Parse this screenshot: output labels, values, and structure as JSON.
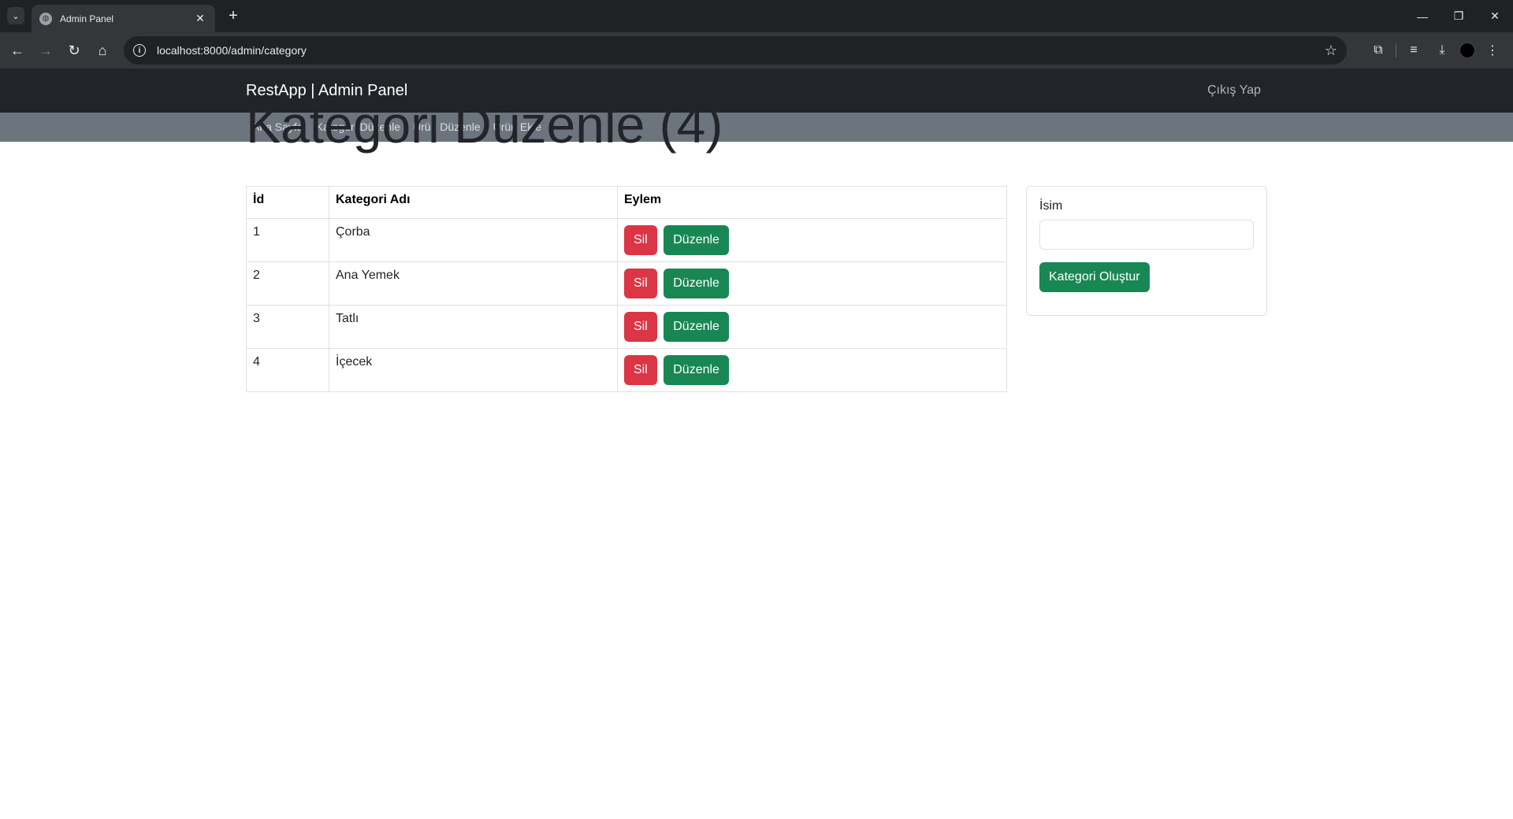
{
  "browser": {
    "tab_title": "Admin Panel",
    "new_tab_glyph": "+",
    "url": "localhost:8000/admin/category"
  },
  "navbar": {
    "brand": "RestApp | Admin Panel",
    "logout": "Çıkış Yap"
  },
  "subnav": {
    "items": [
      "Ana Sayfa",
      "Kategori Düzenle",
      "Ürün Düzenle",
      "Ürün Ekle"
    ]
  },
  "main": {
    "title": "Kategori Düzenle (4)",
    "table": {
      "headers": [
        "İd",
        "Kategori Adı",
        "Eylem"
      ],
      "rows": [
        {
          "id": "1",
          "name": "Çorba"
        },
        {
          "id": "2",
          "name": "Ana Yemek"
        },
        {
          "id": "3",
          "name": "Tatlı"
        },
        {
          "id": "4",
          "name": "İçecek"
        }
      ],
      "delete_label": "Sil",
      "edit_label": "Düzenle"
    },
    "form": {
      "name_label": "İsim",
      "name_value": "",
      "submit_label": "Kategori Oluştur"
    }
  },
  "colors": {
    "navbar": "#212529",
    "subnav": "#6c757d",
    "danger": "#dc3545",
    "success": "#198754"
  }
}
